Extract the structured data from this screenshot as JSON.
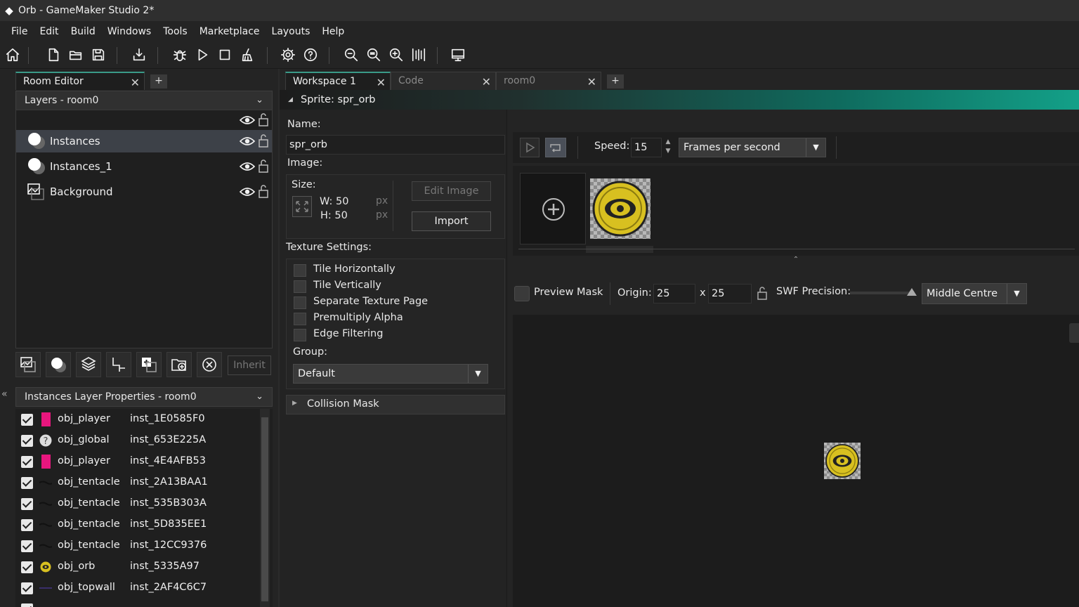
{
  "window": {
    "title": "Orb - GameMaker Studio 2*"
  },
  "menu": [
    "File",
    "Edit",
    "Build",
    "Windows",
    "Tools",
    "Marketplace",
    "Layouts",
    "Help"
  ],
  "left": {
    "tab_label": "Room Editor",
    "tab_add": "+",
    "layers_header": "Layers - room0",
    "layers": [
      {
        "name": "Instances",
        "icon": "instance-layer-icon",
        "selected": true
      },
      {
        "name": "Instances_1",
        "icon": "instance-layer-icon",
        "selected": false
      },
      {
        "name": "Background",
        "icon": "background-layer-icon",
        "selected": false
      }
    ],
    "inherit_label": "Inherit",
    "props_header": "Instances Layer Properties - room0",
    "instances": [
      {
        "object": "obj_player",
        "id": "inst_1E0585F0",
        "icon": "pink-square",
        "color": "#e8167e"
      },
      {
        "object": "obj_global",
        "id": "inst_653E225A",
        "icon": "question-icon"
      },
      {
        "object": "obj_player",
        "id": "inst_4E4AFB53",
        "icon": "pink-square",
        "color": "#e8167e"
      },
      {
        "object": "obj_tentacle",
        "id": "inst_2A13BAA1",
        "icon": "tentacle-icon"
      },
      {
        "object": "obj_tentacle",
        "id": "inst_535B303A",
        "icon": "tentacle-icon"
      },
      {
        "object": "obj_tentacle",
        "id": "inst_5D835EE1",
        "icon": "tentacle-icon"
      },
      {
        "object": "obj_tentacle",
        "id": "inst_12CC9376",
        "icon": "tentacle-icon"
      },
      {
        "object": "obj_orb",
        "id": "inst_5335A97",
        "icon": "orb-icon"
      },
      {
        "object": "obj_topwall",
        "id": "inst_2AF4C6C7",
        "icon": "line-icon"
      }
    ]
  },
  "right": {
    "tabs": [
      {
        "label": "Workspace 1",
        "active": true
      },
      {
        "label": "Code",
        "active": false
      },
      {
        "label": "room0",
        "active": false
      }
    ],
    "tab_add": "+",
    "sprite_header": "Sprite: spr_orb",
    "name_label": "Name:",
    "name_value": "spr_orb",
    "image_label": "Image:",
    "size_label": "Size:",
    "width": "W: 50",
    "height": "H: 50",
    "unit": "px",
    "edit_image": "Edit Image",
    "import": "Import",
    "texture_label": "Texture Settings:",
    "texture_options": [
      "Tile Horizontally",
      "Tile Vertically",
      "Separate Texture Page",
      "Premultiply Alpha",
      "Edge Filtering"
    ],
    "group_label": "Group:",
    "group_value": "Default",
    "collision_mask": "Collision Mask",
    "speed_label": "Speed:",
    "speed_value": "15",
    "speed_unit": "Frames per second",
    "preview_mask": "Preview Mask",
    "origin_label": "Origin:",
    "origin_x": "25",
    "origin_sep": "x",
    "origin_y": "25",
    "swf_label": "SWF Precision:",
    "origin_preset": "Middle Centre"
  },
  "colors": {
    "accent": "#13a088",
    "orb_yellow": "#d8c020",
    "selected_row": "#3d4148"
  }
}
